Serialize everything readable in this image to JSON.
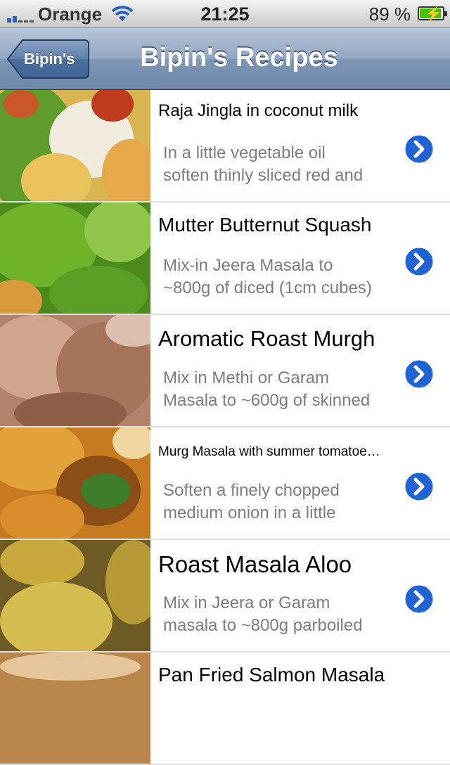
{
  "status_bar": {
    "carrier": "Orange",
    "time": "21:25",
    "battery": "89 %",
    "battery_level": 0.89
  },
  "nav": {
    "back_label": "Bipin's",
    "title": "Bipin's Recipes"
  },
  "recipes": [
    {
      "title": "Raja Jingla in coconut milk",
      "desc_line1": "In a little vegetable oil",
      "desc_line2": "soften thinly sliced red and"
    },
    {
      "title": "Mutter Butternut Squash",
      "desc_line1": "Mix-in Jeera Masala to",
      "desc_line2": "~800g of diced (1cm cubes)"
    },
    {
      "title": "Aromatic Roast Murgh",
      "desc_line1": "Mix in Methi or Garam",
      "desc_line2": "Masala to ~600g of skinned"
    },
    {
      "title": "Murg Masala with summer tomatoe…",
      "desc_line1": "Soften a finely chopped",
      "desc_line2": "medium onion in a little"
    },
    {
      "title": "Roast Masala Aloo",
      "desc_line1": "Mix in Jeera or Garam",
      "desc_line2": "masala to ~800g parboiled"
    },
    {
      "title": "Pan Fried Salmon Masala",
      "desc_line1": "",
      "desc_line2": ""
    }
  ],
  "colors": {
    "nav_tint": "#7e97b7",
    "disclosure_blue": "#1f64d6",
    "desc_gray": "#7d7d7d"
  }
}
